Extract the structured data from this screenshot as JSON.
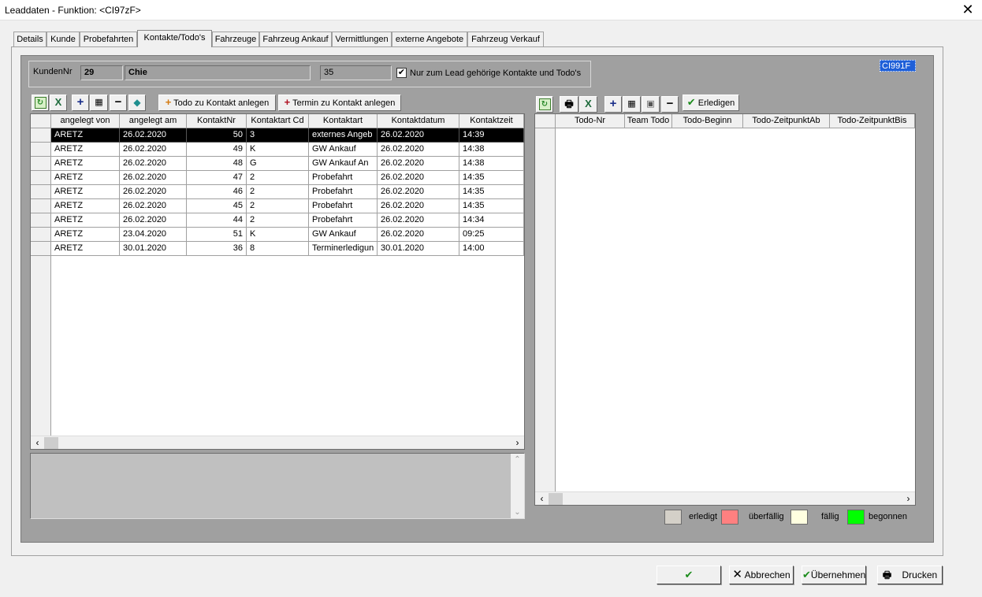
{
  "window": {
    "title": "Leaddaten - Funktion: <CI97zF>",
    "close_glyph": "✕"
  },
  "tabs": [
    {
      "label": "Details"
    },
    {
      "label": "Kunde"
    },
    {
      "label": "Probefahrten"
    },
    {
      "label": "Kontakte/Todo's",
      "active": true
    },
    {
      "label": "Fahrzeuge"
    },
    {
      "label": "Fahrzeug Ankauf"
    },
    {
      "label": "Vermittlungen"
    },
    {
      "label": "externe Angebote"
    },
    {
      "label": "Fahrzeug Verkauf"
    }
  ],
  "header": {
    "kundennr_label": "KundenNr",
    "kundennr_value": "29",
    "name_value": "Chie",
    "count_value": "35",
    "filter_checked": true,
    "filter_label": "Nur zum Lead gehörige Kontakte und Todo's",
    "corner_code": "CI991F"
  },
  "left_toolbar": {
    "todo_button": "Todo zu Kontakt anlegen",
    "termin_button": "Termin zu Kontakt anlegen"
  },
  "contacts": {
    "columns": [
      "angelegt von",
      "angelegt am",
      "KontaktNr",
      "Kontaktart Cd",
      "Kontaktart",
      "Kontaktdatum",
      "Kontaktzeit"
    ],
    "rows": [
      [
        "ARETZ",
        "26.02.2020",
        "50",
        "3",
        "externes Angeb",
        "26.02.2020",
        "14:39"
      ],
      [
        "ARETZ",
        "26.02.2020",
        "49",
        "K",
        "GW Ankauf",
        "26.02.2020",
        "14:38"
      ],
      [
        "ARETZ",
        "26.02.2020",
        "48",
        "G",
        "GW Ankauf An",
        "26.02.2020",
        "14:38"
      ],
      [
        "ARETZ",
        "26.02.2020",
        "47",
        "2",
        "Probefahrt",
        "26.02.2020",
        "14:35"
      ],
      [
        "ARETZ",
        "26.02.2020",
        "46",
        "2",
        "Probefahrt",
        "26.02.2020",
        "14:35"
      ],
      [
        "ARETZ",
        "26.02.2020",
        "45",
        "2",
        "Probefahrt",
        "26.02.2020",
        "14:35"
      ],
      [
        "ARETZ",
        "26.02.2020",
        "44",
        "2",
        "Probefahrt",
        "26.02.2020",
        "14:34"
      ],
      [
        "ARETZ",
        "23.04.2020",
        "51",
        "K",
        "GW Ankauf",
        "26.02.2020",
        "09:25"
      ],
      [
        "ARETZ",
        "30.01.2020",
        "36",
        "8",
        "Terminerledigun",
        "30.01.2020",
        "14:00"
      ]
    ],
    "selected_row": 0
  },
  "right_toolbar": {
    "erledigen_button": "Erledigen"
  },
  "todos": {
    "columns": [
      "Todo-Nr",
      "Team Todo",
      "Todo-Beginn",
      "Todo-ZeitpunktAb",
      "Todo-ZeitpunktBis"
    ]
  },
  "legend": [
    {
      "label": "erledigt",
      "color": "#d4d0c8"
    },
    {
      "label": "überfällig",
      "color": "#ff8080"
    },
    {
      "label": "fällig",
      "color": "#ffffe0"
    },
    {
      "label": "begonnen",
      "color": "#00ff00"
    }
  ],
  "footer": {
    "ok_label": "",
    "cancel_label": "Abbrechen",
    "apply_label": "Übernehmen",
    "print_label": "Drucken"
  }
}
